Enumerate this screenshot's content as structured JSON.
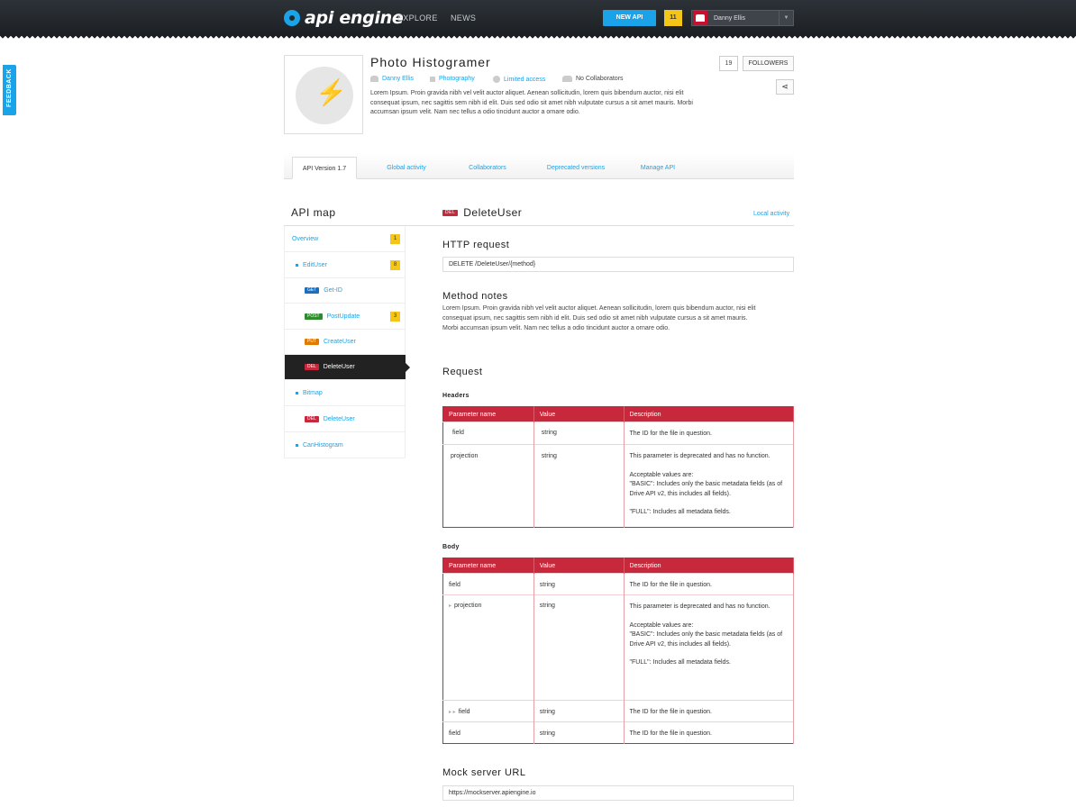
{
  "topbar": {
    "logo_text": "api engine",
    "nav": [
      "EXPLORE",
      "NEWS"
    ],
    "new_api_label": "NEW API",
    "notifications": "11",
    "user_name": "Danny Ellis"
  },
  "feedback_label": "FEEDBACK",
  "api": {
    "title": "Photo Histogramer",
    "author": "Danny Ellis",
    "category": "Photography",
    "access": "Limited access",
    "collaborators": "No Collaborators",
    "description": "Lorem Ipsum. Proin gravida nibh vel velit auctor aliquet. Aenean sollicitudin, lorem quis bibendum auctor, nisi elit consequat ipsum, nec sagittis sem nibh id elit. Duis sed odio sit amet nibh vulputate cursus a sit amet mauris. Morbi accumsan ipsum velit. Nam nec tellus a odio tincidunt auctor a ornare odio.",
    "followers_count": "19",
    "followers_label": "FOLLOWERS"
  },
  "tabs": [
    "API Version 1.7",
    "Global activity",
    "Collaborators",
    "Deprecated versions",
    "Manage API"
  ],
  "sidebar": {
    "title": "API map",
    "items": [
      {
        "label": "Overview",
        "count": "1"
      },
      {
        "label": "EditUser",
        "count": "8"
      },
      {
        "method": "GET",
        "label": "Get-ID"
      },
      {
        "method": "POST",
        "label": "PostUpdate",
        "count": "3"
      },
      {
        "method": "PUT",
        "label": "CreateUser"
      },
      {
        "method": "DEL",
        "label": "DeleteUser"
      },
      {
        "label": "Bitmap"
      },
      {
        "method": "DEL",
        "label": "DeleteUser"
      },
      {
        "label": "CanHistogram"
      }
    ]
  },
  "main": {
    "method": "DEL",
    "title": "DeleteUser",
    "local_activity": "Local activity",
    "http_request_title": "HTTP request",
    "http_request": "DELETE /DeleteUser/{method}",
    "notes_title": "Method notes",
    "notes": "Lorem Ipsum. Proin gravida nibh vel velit auctor aliquet. Aenean sollicitudin, lorem quis bibendum auctor, nisi elit consequat ipsum, nec sagittis sem nibh id elit. Duis sed odio sit amet nibh vulputate cursus a sit amet mauris. Morbi accumsan ipsum velit. Nam nec tellus a odio tincidunt auctor a ornare odio.",
    "request_title": "Request",
    "headers_title": "Headers",
    "body_title": "Body",
    "columns": [
      "Parameter name",
      "Value",
      "Description"
    ],
    "desc_field": "The ID for the file in question.",
    "desc_projection_1": "This parameter is deprecated and has no function.",
    "desc_projection_2": "Acceptable values are:",
    "desc_projection_3": "\"BASIC\": Includes only the basic metadata fields (as of Drive API v2, this includes all fields).",
    "desc_projection_4": "\"FULL\": Includes all metadata fields.",
    "param_field": "field",
    "param_projection": "projection",
    "value_string": "string",
    "mock_title": "Mock server URL",
    "mock_url": "https://mockserver.apiengine.io"
  }
}
